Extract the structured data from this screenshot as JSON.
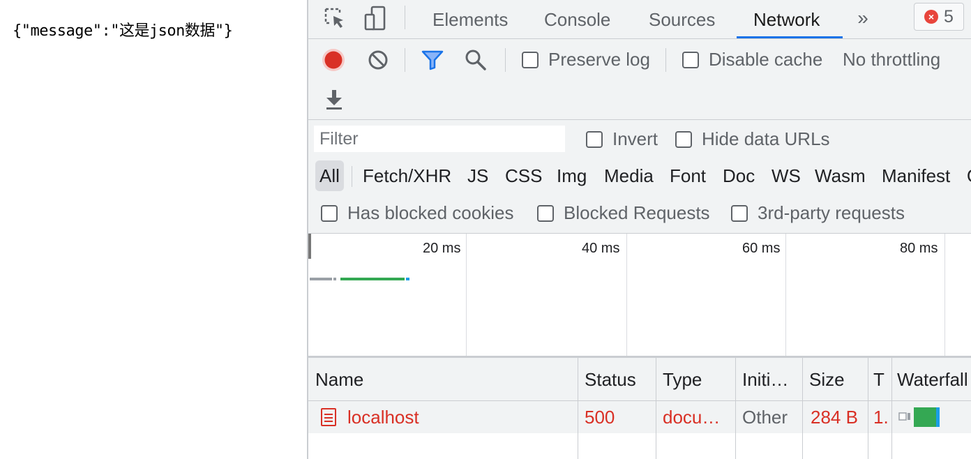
{
  "page": {
    "json_text": "{\"message\":\"这是json数据\"}"
  },
  "devtools": {
    "tabs": [
      {
        "label": "Elements"
      },
      {
        "label": "Console"
      },
      {
        "label": "Sources"
      },
      {
        "label": "Network",
        "active": true
      }
    ],
    "more_tabs_glyph": "»",
    "error_count": "5",
    "icons": {
      "inspect": "inspect-element-icon",
      "device": "device-toolbar-icon",
      "record": "record-icon",
      "clear": "clear-icon",
      "filter": "filter-icon",
      "search": "search-icon",
      "export": "download-icon",
      "error": "error-icon",
      "document": "document-icon"
    },
    "colors": {
      "accent": "#1a73e8",
      "record": "#d93025",
      "error": "#d93025",
      "waiting": "#34a853",
      "download": "#1a9ee6"
    },
    "toolbar": {
      "preserve_log": "Preserve log",
      "disable_cache": "Disable cache",
      "throttling": "No throttling"
    },
    "filter": {
      "placeholder": "Filter",
      "invert": "Invert",
      "hide_data_urls": "Hide data URLs",
      "types": [
        "All",
        "Fetch/XHR",
        "JS",
        "CSS",
        "Img",
        "Media",
        "Font",
        "Doc",
        "WS",
        "Wasm",
        "Manifest",
        "O"
      ],
      "active_type": "All",
      "has_blocked_cookies": "Has blocked cookies",
      "blocked_requests": "Blocked Requests",
      "third_party": "3rd-party requests"
    },
    "overview": {
      "ticks": [
        "20 ms",
        "40 ms",
        "60 ms",
        "80 ms"
      ]
    },
    "table": {
      "columns": [
        "Name",
        "Status",
        "Type",
        "Initi…",
        "Size",
        "T",
        "Waterfall"
      ],
      "rows": [
        {
          "name": "localhost",
          "status": "500",
          "type": "docu…",
          "initiator": "Other",
          "size": "284 B",
          "time": "1."
        }
      ]
    }
  }
}
